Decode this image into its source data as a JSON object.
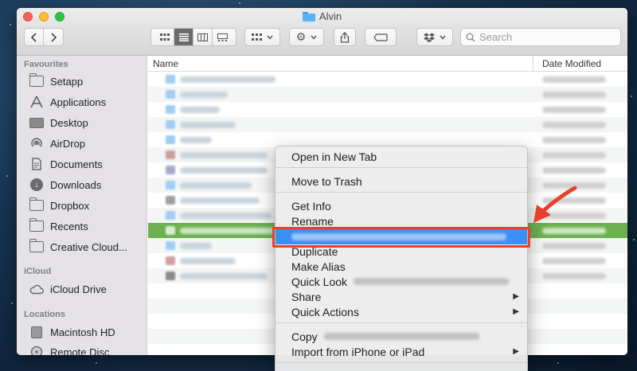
{
  "window": {
    "title": "Alvin"
  },
  "toolbar": {
    "back_icon": "chevron-left-icon",
    "forward_icon": "chevron-right-icon",
    "search_placeholder": "Search"
  },
  "sidebar": {
    "sections": [
      {
        "title": "Favourites",
        "items": [
          {
            "label": "Setapp",
            "icon": "folder-icon"
          },
          {
            "label": "Applications",
            "icon": "applications-icon"
          },
          {
            "label": "Desktop",
            "icon": "desktop-icon"
          },
          {
            "label": "AirDrop",
            "icon": "airdrop-icon"
          },
          {
            "label": "Documents",
            "icon": "documents-icon"
          },
          {
            "label": "Downloads",
            "icon": "downloads-icon"
          },
          {
            "label": "Dropbox",
            "icon": "folder-icon"
          },
          {
            "label": "Recents",
            "icon": "recents-icon"
          },
          {
            "label": "Creative Cloud...",
            "icon": "folder-icon"
          }
        ]
      },
      {
        "title": "iCloud",
        "items": [
          {
            "label": "iCloud Drive",
            "icon": "cloud-icon"
          }
        ]
      },
      {
        "title": "Locations",
        "items": [
          {
            "label": "Macintosh HD",
            "icon": "disk-icon"
          },
          {
            "label": "Remote Disc",
            "icon": "disc-icon"
          }
        ]
      }
    ]
  },
  "file_list": {
    "columns": [
      "Name",
      "Date Modified"
    ]
  },
  "context_menu": {
    "items": {
      "open_new_tab": "Open in New Tab",
      "move_to_trash": "Move to Trash",
      "get_info": "Get Info",
      "rename": "Rename",
      "duplicate": "Duplicate",
      "make_alias": "Make Alias",
      "quick_look": "Quick Look",
      "share": "Share",
      "quick_actions": "Quick Actions",
      "copy": "Copy",
      "import_iphone": "Import from iPhone or iPad"
    }
  },
  "colors": {
    "highlight": "#3a8ff2",
    "annotation": "#e8402a",
    "selected_row": "#6cb04f"
  }
}
